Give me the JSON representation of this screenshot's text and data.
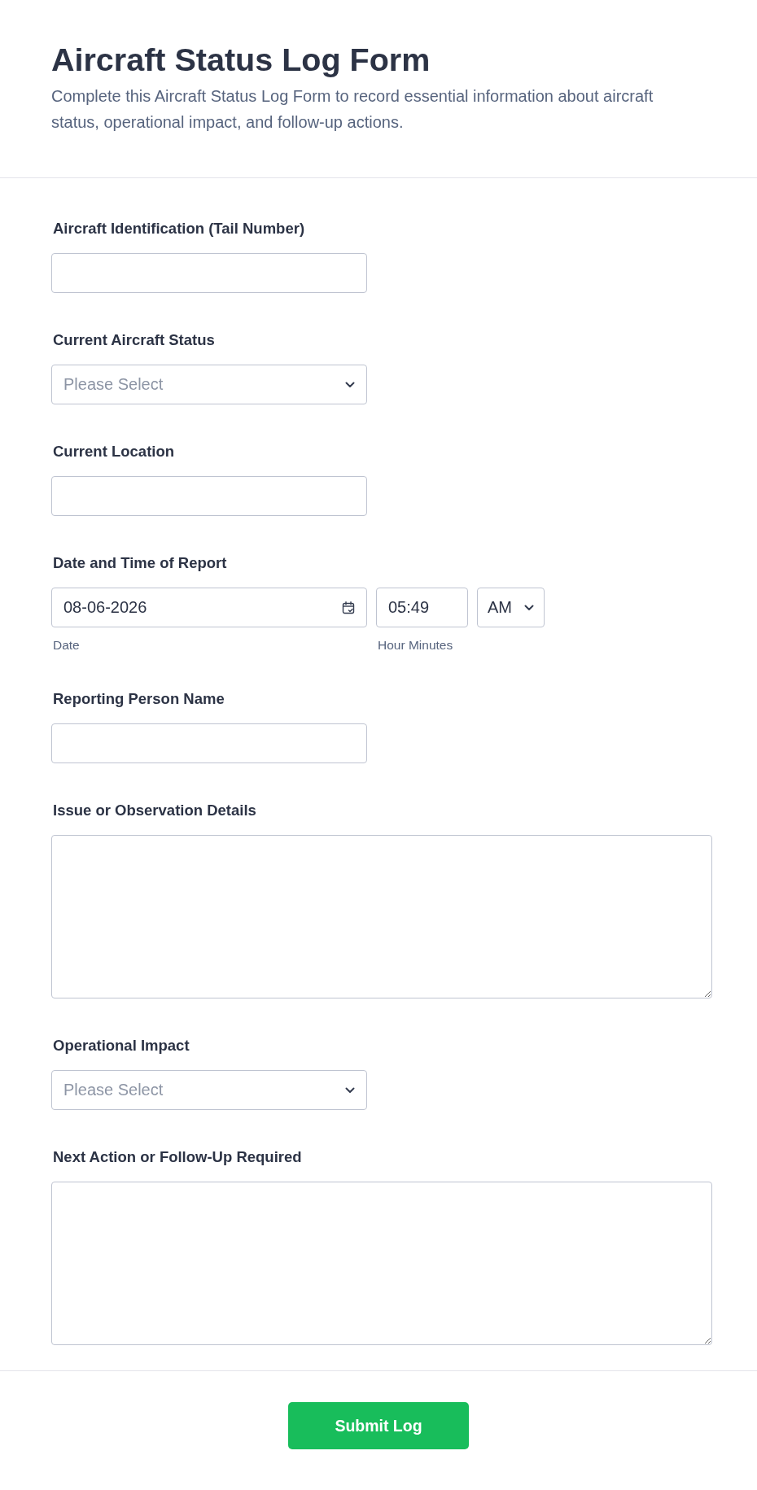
{
  "header": {
    "title": "Aircraft Status Log Form",
    "description": "Complete this Aircraft Status Log Form to record essential information about aircraft status, operational impact, and follow-up actions."
  },
  "fields": [
    {
      "kind": "text",
      "label": "Aircraft Identification (Tail Number)"
    },
    {
      "kind": "select",
      "label": "Current Aircraft Status",
      "placeholder": "Please Select"
    },
    {
      "kind": "text",
      "label": "Current Location"
    },
    {
      "kind": "datetime",
      "label": "Date and Time of Report",
      "date": {
        "value": "08-06-2026",
        "sublabel": "Date"
      },
      "time": {
        "value": "05:49",
        "sublabel": "Hour Minutes"
      },
      "ampm": {
        "value": "AM"
      }
    },
    {
      "kind": "text",
      "label": "Reporting Person Name"
    },
    {
      "kind": "textarea",
      "label": "Issue or Observation Details"
    },
    {
      "kind": "select",
      "label": "Operational Impact",
      "placeholder": "Please Select"
    },
    {
      "kind": "textarea",
      "label": "Next Action or Follow-Up Required"
    }
  ],
  "submit": {
    "label": "Submit Log"
  }
}
